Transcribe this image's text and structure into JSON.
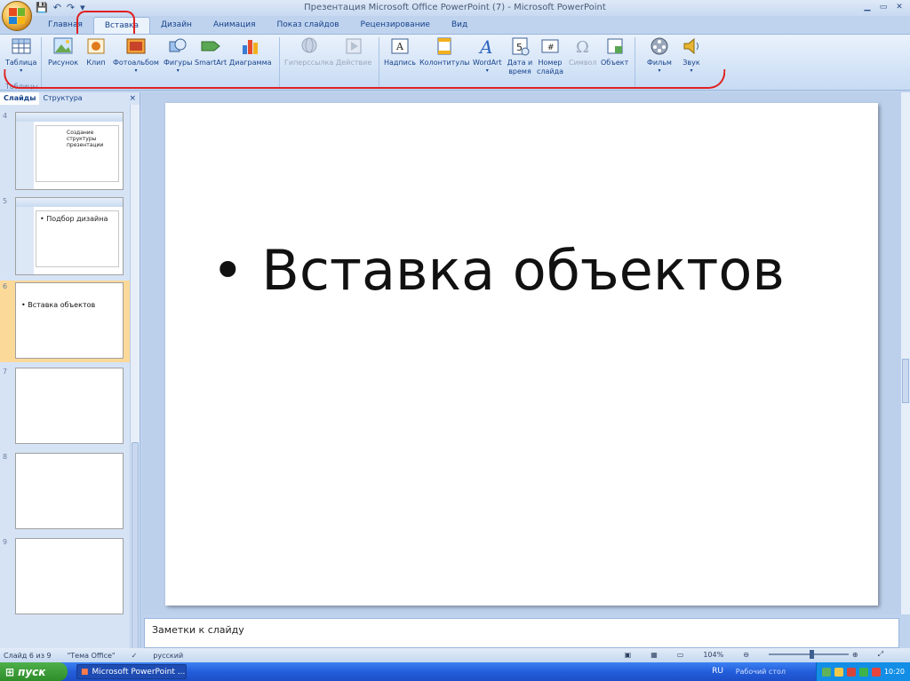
{
  "window": {
    "title": "Презентация Microsoft Office PowerPoint (7) - Microsoft PowerPoint",
    "qat": [
      "save",
      "undo",
      "redo"
    ],
    "controls": [
      "minimize",
      "maximize",
      "close"
    ]
  },
  "tabs": [
    "Главная",
    "Вставка",
    "Дизайн",
    "Анимация",
    "Показ слайдов",
    "Рецензирование",
    "Вид"
  ],
  "ribbon": {
    "buttons": [
      {
        "label": "Таблица",
        "icon": "table-icon"
      },
      {
        "label": "Рисунок",
        "icon": "picture-icon"
      },
      {
        "label": "Клип",
        "icon": "clip-icon"
      },
      {
        "label": "Фотоальбом",
        "icon": "photo-album-icon"
      },
      {
        "label": "Фигуры",
        "icon": "shapes-icon"
      },
      {
        "label": "SmartArt",
        "icon": "smartart-icon"
      },
      {
        "label": "Диаграмма",
        "icon": "chart-icon"
      },
      {
        "label": "Гиперссылка",
        "icon": "hyperlink-icon"
      },
      {
        "label": "Действие",
        "icon": "action-icon"
      },
      {
        "label": "Надпись",
        "icon": "textbox-icon"
      },
      {
        "label": "Колонтитулы",
        "icon": "header-footer-icon"
      },
      {
        "label": "WordArt",
        "icon": "wordart-icon"
      },
      {
        "label": "Дата и время",
        "icon": "date-time-icon"
      },
      {
        "label": "Номер слайда",
        "icon": "slide-number-icon"
      },
      {
        "label": "Символ",
        "icon": "symbol-icon"
      },
      {
        "label": "Объект",
        "icon": "object-icon"
      },
      {
        "label": "Фильм",
        "icon": "movie-icon"
      },
      {
        "label": "Звук",
        "icon": "sound-icon"
      }
    ],
    "group_tables": "Таблицы"
  },
  "panel": {
    "tab_slides": "Слайды",
    "tab_outline": "Структура",
    "close": "×",
    "slides": [
      {
        "num": "4",
        "text": "Создание структуры презентации"
      },
      {
        "num": "5",
        "text": "• Подбор дизайна"
      },
      {
        "num": "6",
        "text": "• Вставка объектов"
      },
      {
        "num": "7",
        "text": ""
      },
      {
        "num": "8",
        "text": ""
      },
      {
        "num": "9",
        "text": ""
      }
    ]
  },
  "slide": {
    "bullet": "• Вставка объектов"
  },
  "notes": {
    "placeholder": "Заметки к слайду"
  },
  "status": {
    "slide": "Слайд 6 из 9",
    "theme": "\"Тема Office\"",
    "lang": "русский",
    "zoom": "104%"
  },
  "taskbar": {
    "start": "пуск",
    "task": "Microsoft PowerPoint ...",
    "lang": "RU",
    "desktop": "Рабочий стол",
    "time": "10:20"
  }
}
